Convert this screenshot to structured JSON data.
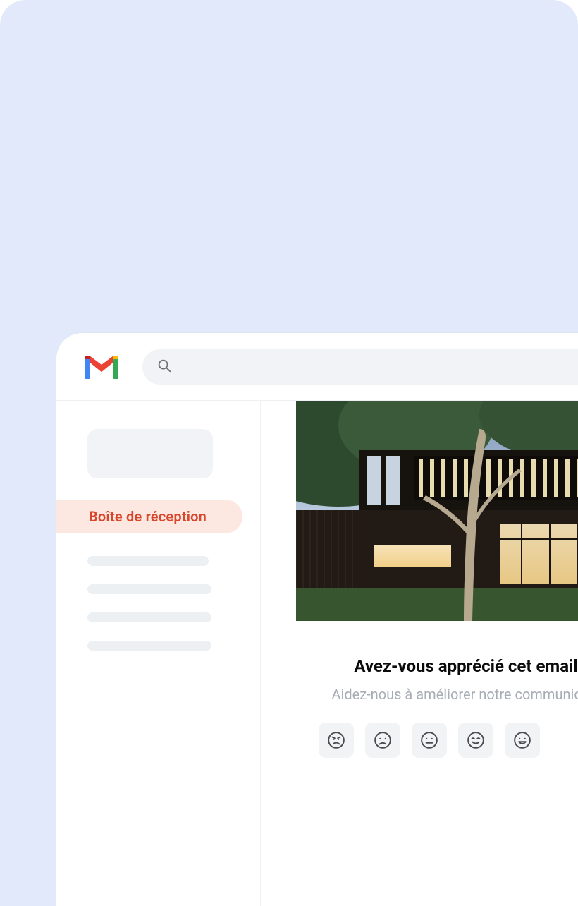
{
  "search": {
    "placeholder": ""
  },
  "sidebar": {
    "active_label": "Boîte de réception"
  },
  "email": {
    "question_title": "Avez-vous apprécié cet email ?",
    "question_sub": "Aidez-nous à améliorer notre communication",
    "faces": [
      {
        "name": "rating-very-bad"
      },
      {
        "name": "rating-bad"
      },
      {
        "name": "rating-neutral"
      },
      {
        "name": "rating-good"
      },
      {
        "name": "rating-very-good"
      }
    ]
  },
  "icons": {
    "logo": "gmail-logo",
    "search": "search-icon"
  }
}
